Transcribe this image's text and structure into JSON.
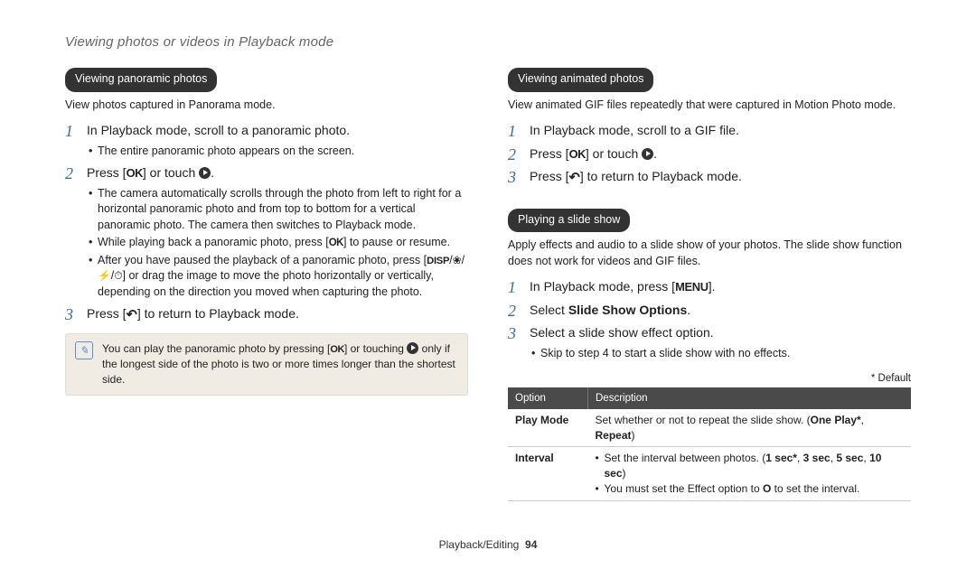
{
  "header": {
    "breadcrumb": "Viewing photos or videos in Playback mode"
  },
  "left": {
    "pill": "Viewing panoramic photos",
    "lead": "View photos captured in Panorama mode.",
    "step1": {
      "text": "In Playback mode, scroll to a panoramic photo.",
      "sub1": "The entire panoramic photo appears on the screen."
    },
    "step2": {
      "prefix": "Press [",
      "mid": "] or touch ",
      "suffix": ".",
      "sub1_a": "The camera automatically scrolls through the photo from left to right for a horizontal panoramic photo and from top to bottom for a vertical panoramic photo. The camera then switches to Playback mode.",
      "sub2_a": "While playing back a panoramic photo, press [",
      "sub2_b": "] to pause or resume.",
      "sub3_a": "After you have paused the playback of a panoramic photo, press [",
      "sub3_b": "] or drag the image to move the photo horizontally or vertically, depending on the direction you moved when capturing the photo."
    },
    "step3": {
      "prefix": "Press [",
      "suffix": "] to return to Playback mode."
    },
    "note": {
      "a": "You can play the panoramic photo by pressing [",
      "b": "] or touching ",
      "c": " only if the longest side of the photo is two or more times longer than the shortest side."
    }
  },
  "right": {
    "pill1": "Viewing animated photos",
    "lead1": "View animated GIF files repeatedly that were captured in Motion Photo mode.",
    "r1_step1": "In Playback mode, scroll to a GIF file.",
    "r1_step2_a": "Press [",
    "r1_step2_b": "] or touch ",
    "r1_step2_c": ".",
    "r1_step3_a": "Press [",
    "r1_step3_b": "] to return to Playback mode.",
    "pill2": "Playing a slide show",
    "lead2": "Apply effects and audio to a slide show of your photos. The slide show function does not work for videos and GIF files.",
    "r2_step1_a": "In Playback mode, press [",
    "r2_step1_b": "].",
    "r2_step2_a": "Select ",
    "r2_step2_b": "Slide Show Options",
    "r2_step2_c": ".",
    "r2_step3": "Select a slide show effect option.",
    "r2_step3_sub": "Skip to step 4 to start a slide show with no effects.",
    "default_note": "* Default",
    "table": {
      "h1": "Option",
      "h2": "Description",
      "row1": {
        "opt": "Play Mode",
        "desc_a": "Set whether or not to repeat the slide show. (",
        "desc_b": "One Play*",
        "desc_c": ", ",
        "desc_d": "Repeat",
        "desc_e": ")"
      },
      "row2": {
        "opt": "Interval",
        "li1_a": "Set the interval between photos. (",
        "li1_b": "1 sec*",
        "li1_c": ", ",
        "li1_d": "3 sec",
        "li1_e": ", ",
        "li1_f": "5 sec",
        "li1_g": ", ",
        "li1_h": "10 sec",
        "li1_i": ")",
        "li2_a": "You must set the Effect option to ",
        "li2_b": "O",
        "li2_c": " to set the interval."
      }
    }
  },
  "footer": {
    "section": "Playback/Editing",
    "page": "94"
  }
}
